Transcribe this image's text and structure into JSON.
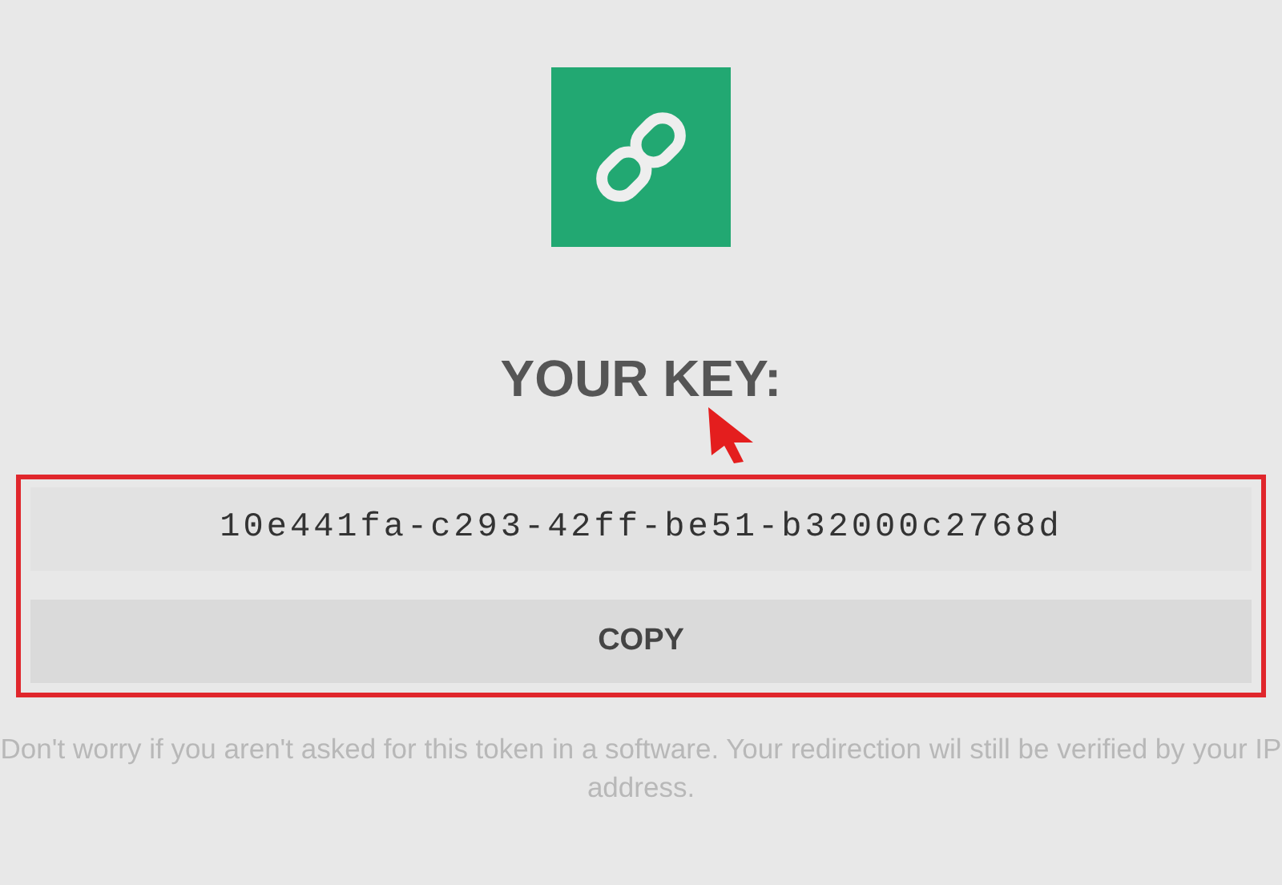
{
  "title": "YOUR KEY:",
  "key": "10e441fa-c293-42ff-be51-b32000c2768d",
  "copy_button": "COPY",
  "note": "Don't worry if you aren't asked for this token in a software. Your redirection wil still be verified by your IP address."
}
